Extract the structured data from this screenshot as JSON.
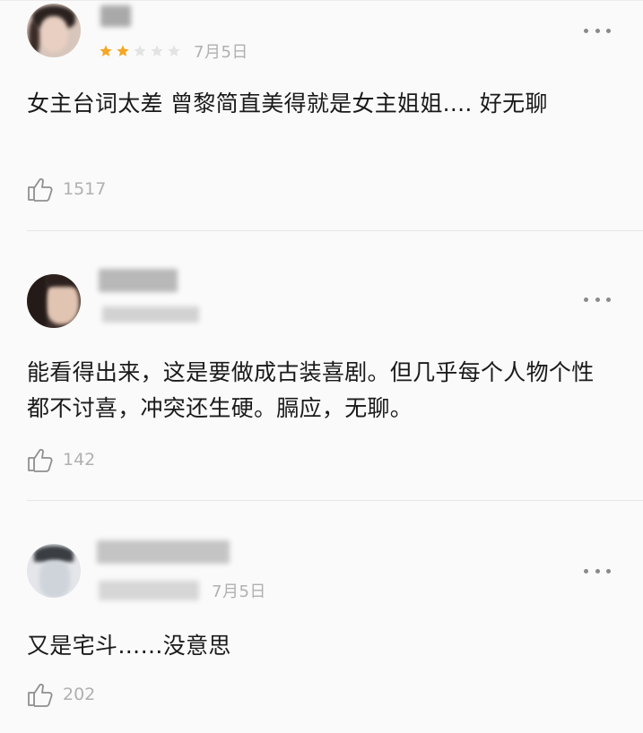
{
  "comments": [
    {
      "rating_stars": 2,
      "rating_max": 5,
      "date": "7月5日",
      "text": "女主台词太差 曾黎简直美得就是女主姐姐.... 好无聊",
      "likes": "1517"
    },
    {
      "date_partial": "昨天",
      "text": "能看得出来，这是要做成古装喜剧。但几乎每个人物个性都不讨喜，冲突还生硬。膈应，无聊。",
      "likes": "142"
    },
    {
      "name_partial": "旅行者三",
      "date": "7月5日",
      "text": "又是宅斗……没意思",
      "likes": "202"
    }
  ],
  "colors": {
    "star_filled": "#f5a623",
    "star_empty": "#e3e3e3",
    "meta_gray": "#b0b0b0",
    "text": "#1a1a1a",
    "divider": "#e6e6e6"
  },
  "icons": {
    "like": "thumbs-up-outline-icon",
    "more": "more-dots-icon",
    "star": "star-icon"
  }
}
